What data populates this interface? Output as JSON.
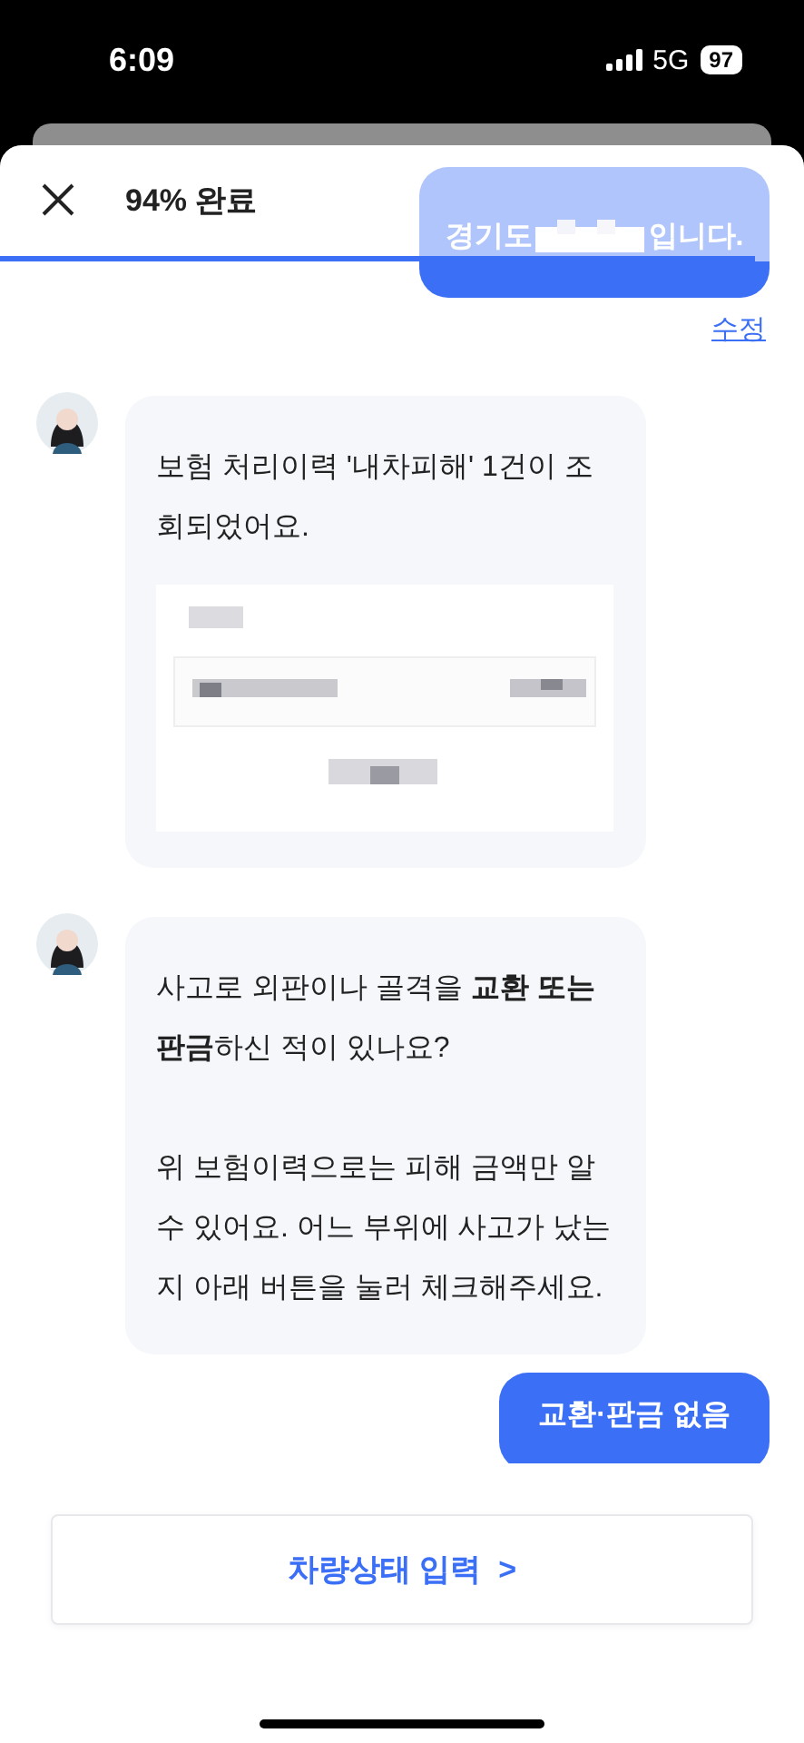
{
  "status_bar": {
    "time": "6:09",
    "network": "5G",
    "battery": "97"
  },
  "header": {
    "progress_label": "94% 완료",
    "level": 0.94
  },
  "previous_answer": {
    "text_before": "경기도",
    "text_after": "입니다.",
    "edit_link": "수정"
  },
  "messages": [
    {
      "kind": "bot",
      "paragraphs": [
        "보험 처리이력 '내차피해' 1건이 조회되었어요."
      ],
      "card": {
        "kind": "picture"
      }
    },
    {
      "kind": "bot",
      "paragraphs": [
        "사고로 외판이나 골격을 **교환 또는 판금**하신 적이 있나요?",
        "위 보험이력으로는 피해 금액만 알 수 있어요. 어느 부위에 사고가 났는지 아래 버튼을 눌러 체크해주세요."
      ]
    },
    {
      "kind": "user",
      "paragraphs": [
        "교환·판금 없음"
      ]
    }
  ],
  "action_button": {
    "label": "차량상태 입력",
    "arrow": ">"
  }
}
